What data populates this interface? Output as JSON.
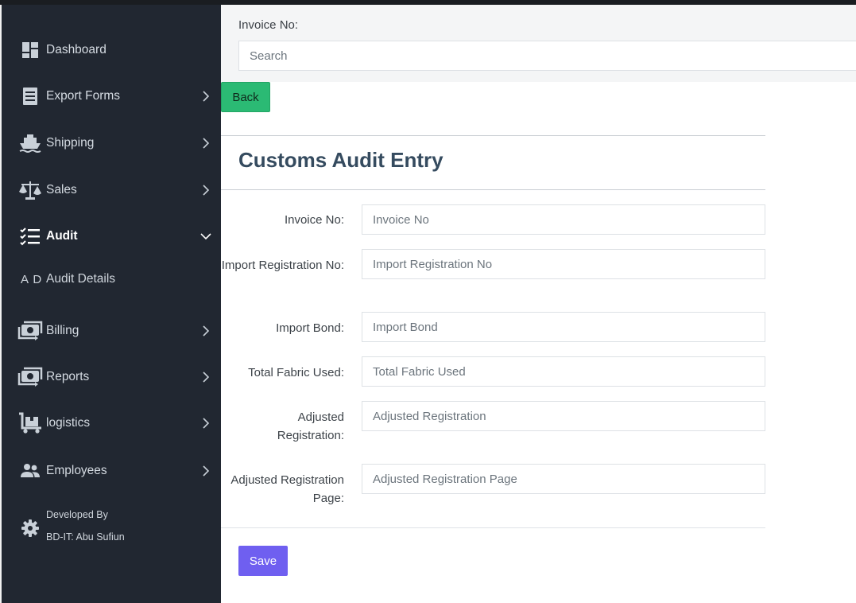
{
  "sidebar": {
    "items": [
      {
        "label": "Dashboard",
        "icon": "dashboard-icon",
        "has_chevron": false
      },
      {
        "label": "Export Forms",
        "icon": "form-icon",
        "has_chevron": true
      },
      {
        "label": "Shipping",
        "icon": "ship-icon",
        "has_chevron": true
      },
      {
        "label": "Sales",
        "icon": "scale-icon",
        "has_chevron": true
      },
      {
        "label": "Audit",
        "icon": "checklist-icon",
        "has_chevron": true,
        "expanded": true
      },
      {
        "label": "Billing",
        "icon": "money-exchange-icon",
        "has_chevron": true
      },
      {
        "label": "Reports",
        "icon": "money-exchange-icon",
        "has_chevron": true
      },
      {
        "label": "logistics",
        "icon": "cart-icon",
        "has_chevron": true
      },
      {
        "label": "Employees",
        "icon": "people-icon",
        "has_chevron": true
      }
    ],
    "subitem": {
      "abbr": "A D",
      "label": "Audit Details"
    },
    "developer": {
      "line1": "Developed By",
      "line2": "BD-IT: Abu Sufiun",
      "icon": "gear-icon"
    }
  },
  "search": {
    "label": "Invoice No:",
    "placeholder": "Search"
  },
  "back_label": "Back",
  "title": "Customs Audit Entry",
  "fields": [
    {
      "label": "Invoice No:",
      "placeholder": "Invoice No"
    },
    {
      "label": "Import Registration No:",
      "placeholder": "Import Registration No"
    },
    {
      "label": "Import Bond:",
      "placeholder": "Import Bond"
    },
    {
      "label": "Total Fabric Used:",
      "placeholder": "Total Fabric Used"
    },
    {
      "label": "Adjusted Registration:",
      "placeholder": "Adjusted Registration"
    },
    {
      "label": "Adjusted Registration Page:",
      "placeholder": "Adjusted Registration Page"
    }
  ],
  "save_label": "Save",
  "colors": {
    "sidebar": "#212731",
    "back_button": "#2bba74",
    "save_button": "#6f5ff0",
    "title": "#354b5f"
  }
}
